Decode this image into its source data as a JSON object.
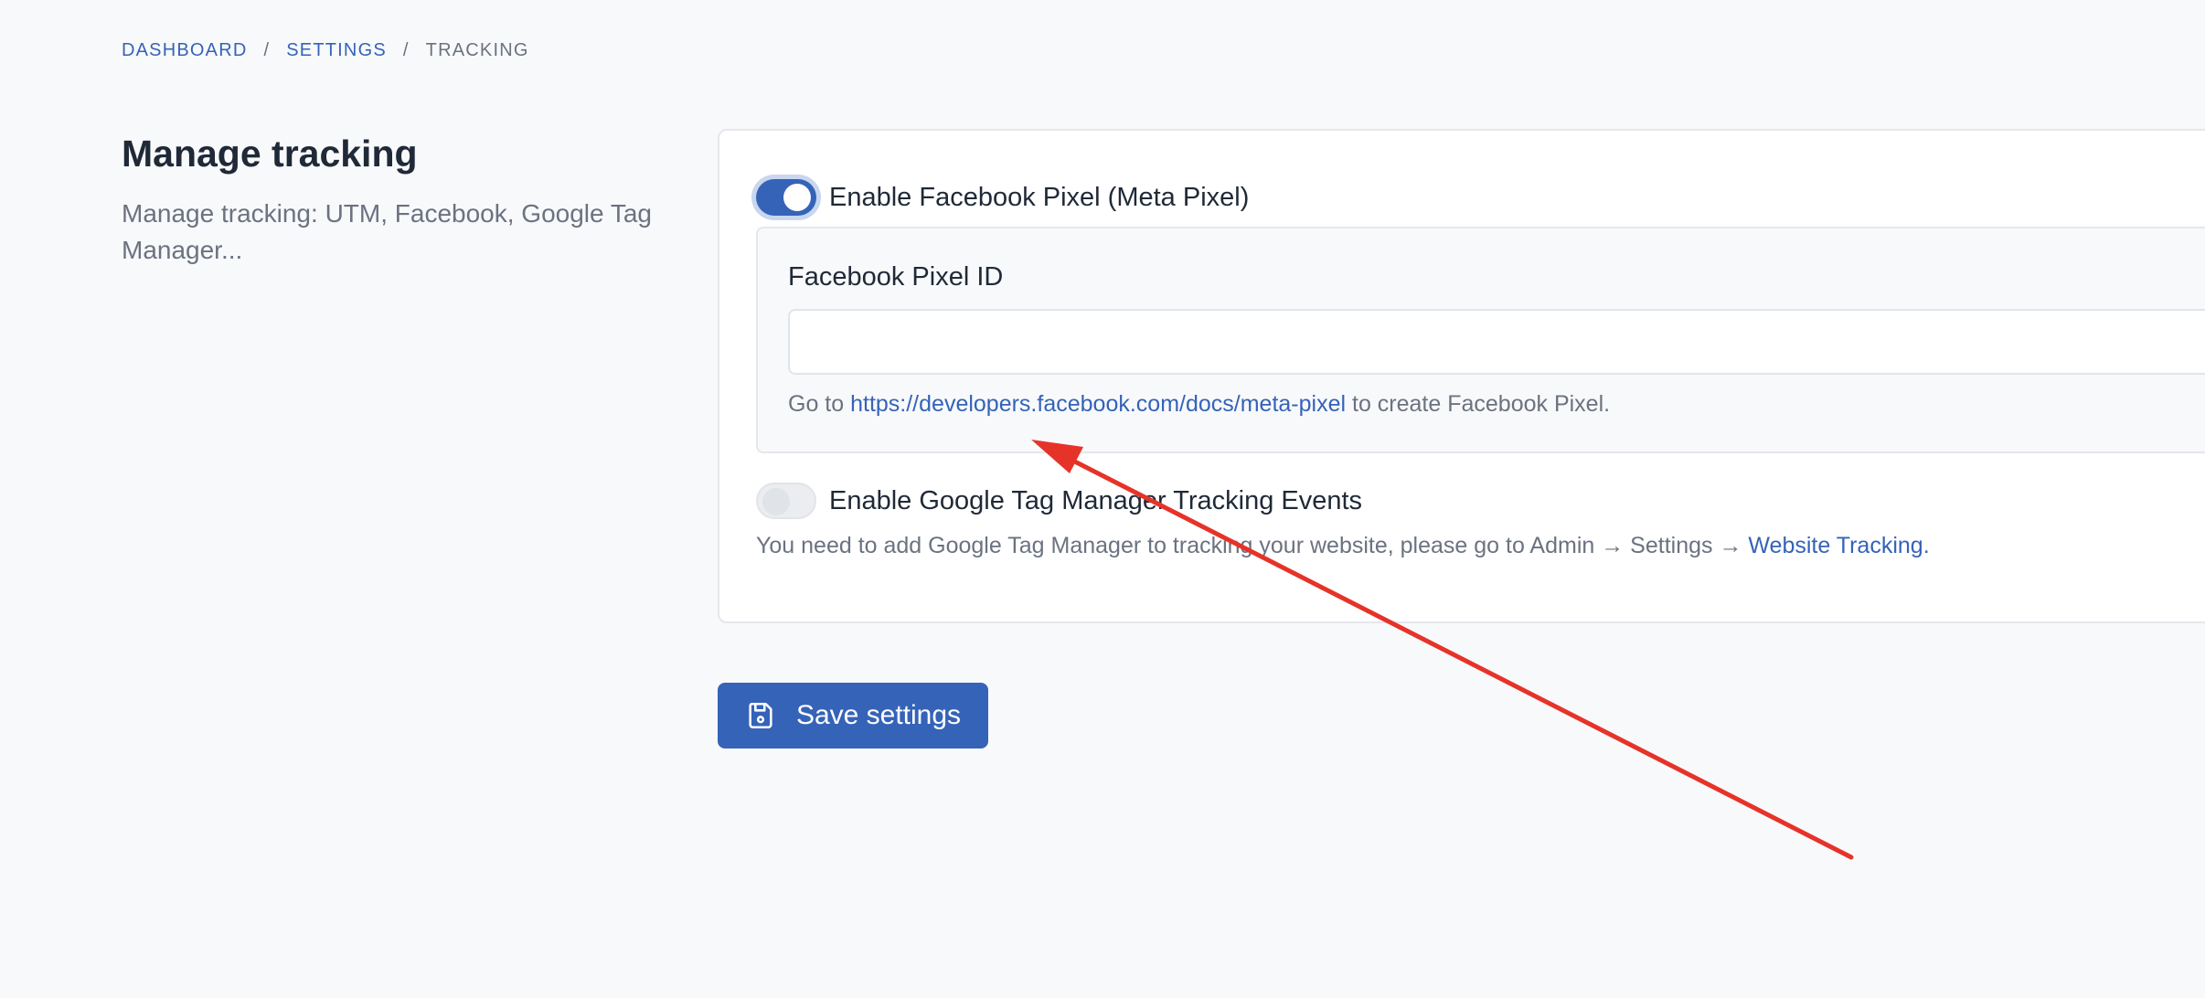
{
  "breadcrumb": {
    "items": [
      "DASHBOARD",
      "SETTINGS"
    ],
    "separator": "/",
    "current": "TRACKING"
  },
  "page": {
    "title": "Manage tracking",
    "description": "Manage tracking: UTM, Facebook, Google Tag Manager..."
  },
  "facebook": {
    "toggle_label": "Enable Facebook Pixel (Meta Pixel)",
    "enabled": true,
    "pixel_id_label": "Facebook Pixel ID",
    "pixel_id_value": "",
    "help_prefix": "Go to ",
    "help_link": "https://developers.facebook.com/docs/meta-pixel",
    "help_suffix": " to create Facebook Pixel."
  },
  "gtm": {
    "toggle_label": "Enable Google Tag Manager Tracking Events",
    "enabled": false,
    "help_prefix": "You need to add Google Tag Manager to tracking your website, please go to Admin → Settings → ",
    "help_link": "Website Tracking."
  },
  "actions": {
    "save_label": "Save settings",
    "save_icon": "floppy-disk-icon"
  },
  "colors": {
    "accent": "#3563b8",
    "annotation": "#e63329"
  }
}
